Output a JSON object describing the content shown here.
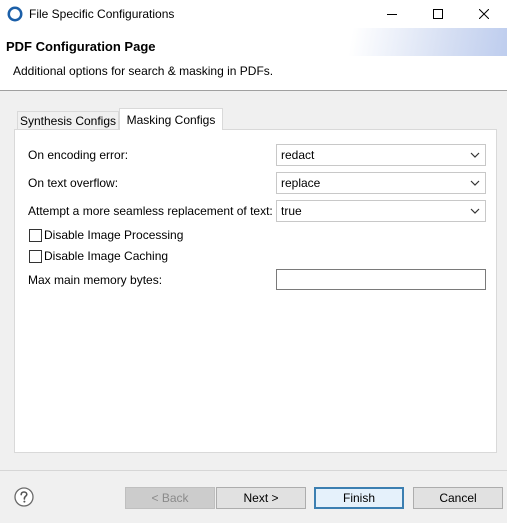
{
  "window": {
    "title": "File Specific Configurations"
  },
  "header": {
    "title": "PDF Configuration Page",
    "description": "Additional options for search & masking in PDFs."
  },
  "tabs": [
    {
      "label": "Synthesis Configs",
      "selected": false
    },
    {
      "label": "Masking Configs",
      "selected": true
    }
  ],
  "form": {
    "encoding_error": {
      "label": "On encoding error:",
      "value": "redact"
    },
    "text_overflow": {
      "label": "On text overflow:",
      "value": "replace"
    },
    "seamless_replacement": {
      "label": "Attempt a more seamless replacement of text:",
      "value": "true"
    },
    "disable_image_processing": {
      "label": "Disable Image Processing",
      "checked": false
    },
    "disable_image_caching": {
      "label": "Disable Image Caching",
      "checked": false
    },
    "max_memory": {
      "label": "Max main memory bytes:",
      "value": ""
    }
  },
  "buttons": {
    "back": "< Back",
    "next": "Next >",
    "finish": "Finish",
    "cancel": "Cancel"
  },
  "colors": {
    "accent_border": "#3c7fb1",
    "panel_bg": "#f0f0f0"
  }
}
